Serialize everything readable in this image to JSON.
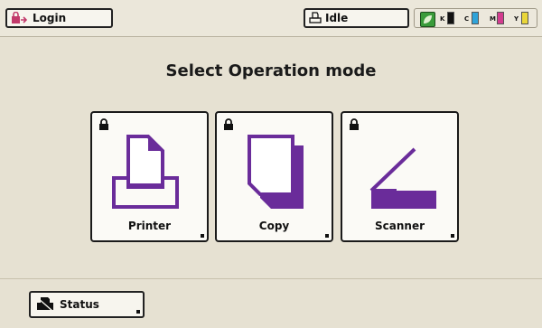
{
  "header": {
    "login_label": "Login",
    "status_label": "Idle",
    "toner": [
      {
        "label": "K",
        "color": "#111111"
      },
      {
        "label": "C",
        "color": "#2fa3d9"
      },
      {
        "label": "M",
        "color": "#d43c8f"
      },
      {
        "label": "Y",
        "color": "#e9d63a"
      }
    ]
  },
  "main": {
    "title": "Select Operation mode",
    "modes": [
      {
        "label": "Printer",
        "icon": "printer-icon",
        "locked": true
      },
      {
        "label": "Copy",
        "icon": "copy-icon",
        "locked": true
      },
      {
        "label": "Scanner",
        "icon": "scanner-icon",
        "locked": true
      }
    ]
  },
  "footer": {
    "status_label": "Status"
  },
  "colors": {
    "accent": "#6a2c9a",
    "login_icon": "#c23a6b",
    "eco": "#3a9b3a"
  }
}
